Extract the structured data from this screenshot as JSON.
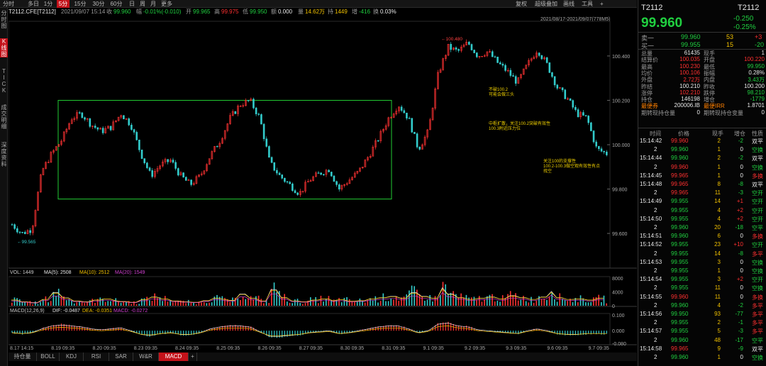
{
  "toolbar": {
    "tabs": [
      "分时",
      "多日",
      "1分",
      "5分",
      "15分",
      "30分",
      "60分",
      "日",
      "周",
      "月",
      "更多"
    ],
    "active": "5分",
    "right": [
      "复权",
      "超级叠加",
      "画线",
      "工具",
      "+"
    ]
  },
  "sidebar": {
    "items": [
      "分\n时\n图",
      "K\n线\n图",
      "T\nI\nC\nK",
      "成\n交\n明\n细",
      "深\n度\n资\n料"
    ],
    "active": 1
  },
  "info": {
    "symbol": "T2112.CFE[T2112]",
    "datetime": "2021/09/07 15:14",
    "close_label": "收",
    "close": "99.960",
    "change_label": "幅",
    "change": "-0.01%(-0.010)",
    "open_label": "开",
    "open": "99.965",
    "high_label": "高",
    "high": "99.975",
    "low_label": "低",
    "low": "99.950",
    "amount_label": "额",
    "amount": "0.000",
    "vol_label": "量",
    "vol": "14.62万",
    "oi_label": "持",
    "oi": "1449",
    "oi_chg_label": "增",
    "oi_chg": "-416",
    "turnover_label": "换",
    "turnover": "0.03%"
  },
  "range": "2021/08/17-2021/09/07(778M5)",
  "chart_data": [
    {
      "type": "candlestick",
      "ylim": [
        99.45,
        100.55
      ],
      "yticks": [
        "100.400",
        "100.200",
        "100.000",
        "99.800",
        "99.600"
      ],
      "high_label": "100.480",
      "low_label": "99.565",
      "x_labels": [
        "8.17 14:15",
        "8.19 09:35",
        "8.20 09:35",
        "8.23 09:35",
        "8.24 09:35",
        "8.25 09:35",
        "8.26 09:35",
        "8.27 09:35",
        "8.30 09:35",
        "8.31 09:35",
        "9.1 09:35",
        "9.2 09:35",
        "9.3 09:35",
        "9.6 09:35",
        "9.7 09:35"
      ],
      "close": [
        99.64,
        99.6,
        99.62,
        99.88,
        99.96,
        100.02,
        100.12,
        100.14,
        100.09,
        100.06,
        100.08,
        100.14,
        100.09,
        99.96,
        99.86,
        99.91,
        99.93,
        99.86,
        99.82,
        99.86,
        99.95,
        100.02,
        100.12,
        100.18,
        100.2,
        100.12,
        99.92,
        99.86,
        99.82,
        99.78,
        99.84,
        99.87,
        99.89,
        99.8,
        99.84,
        99.88,
        99.95,
        100.03,
        100.12,
        100.18,
        100.12,
        99.98,
        100.06,
        100.32,
        100.44,
        100.42,
        100.46,
        100.4,
        100.42,
        100.37,
        100.33,
        100.28,
        100.36,
        100.43,
        100.36,
        100.26,
        100.21,
        100.14,
        100.12,
        99.98,
        99.96
      ],
      "annotations": [
        "不破100.2\n可能会做三头",
        "中枢扩散，关注100.2突破有效性\n100.3附近压力位",
        "关注100的支撑性\n100.2-100.3做空观有效性有点\n找空"
      ]
    },
    {
      "type": "bar",
      "title": "VOL: 1449",
      "ma5": "MA(5): 2508",
      "ma10": "MA(10): 2512",
      "ma20": "MA(20): 1549",
      "ylim": [
        0,
        8000
      ],
      "yticks": [
        "8000",
        "4000",
        "0"
      ],
      "values": [
        1800,
        1200,
        900,
        2000,
        4200,
        2500,
        1500,
        1200,
        1800,
        2200,
        1600,
        1300,
        1000,
        1900,
        2800,
        2200,
        1500,
        1200,
        1000,
        1600,
        2400,
        2000,
        1700,
        3800,
        2400,
        1500,
        5200,
        2600,
        1500,
        1200,
        1800,
        2200,
        1500,
        1900,
        1400,
        1600,
        2200,
        2600,
        3000,
        2400,
        4200,
        3000,
        2400,
        5800,
        3800,
        2600,
        2000,
        2400,
        2800,
        2200,
        3200,
        2600,
        2000,
        2800,
        4600,
        2600,
        2000,
        2200,
        1800,
        2400,
        1449
      ]
    },
    {
      "type": "bar",
      "title": "MACD(12,26,9)",
      "dif": "DIF: -0.0487",
      "dea": "DEA: -0.0351",
      "macd": "MACD: -0.0272",
      "ylim": [
        -0.08,
        0.1
      ],
      "yticks": [
        "0.100",
        "0.000",
        "-0.080"
      ],
      "macd_values": [
        -0.02,
        -0.03,
        -0.02,
        0.02,
        0.05,
        0.06,
        0.05,
        0.04,
        0.02,
        0.01,
        0.02,
        0.03,
        0.0,
        -0.04,
        -0.05,
        -0.03,
        -0.02,
        -0.04,
        -0.04,
        -0.02,
        0.02,
        0.04,
        0.05,
        0.05,
        0.04,
        -0.01,
        -0.06,
        -0.06,
        -0.05,
        -0.04,
        -0.02,
        -0.01,
        0.0,
        -0.03,
        -0.02,
        0.0,
        0.02,
        0.04,
        0.05,
        0.05,
        0.02,
        -0.02,
        0.0,
        0.07,
        0.08,
        0.05,
        0.04,
        0.01,
        0.0,
        -0.01,
        -0.02,
        -0.03,
        0.0,
        0.02,
        0.0,
        -0.03,
        -0.04,
        -0.04,
        -0.03,
        -0.03,
        -0.03
      ]
    }
  ],
  "bottom_tabs": [
    "持仓量",
    "BOLL",
    "KDJ",
    "RSI",
    "SAR",
    "W&R",
    "MACD",
    "+"
  ],
  "bottom_active": "MACD",
  "quote": {
    "code": "T2112",
    "code2": "T2112",
    "change": "-0.250",
    "pct": "-0.25%",
    "price": "99.960",
    "orders": [
      [
        "卖一",
        "99.960",
        "53",
        "+3"
      ],
      [
        "买一",
        "99.955",
        "15",
        "-20"
      ]
    ],
    "stats": [
      [
        "总量",
        "61435",
        "现手",
        "1"
      ],
      [
        "结算价",
        "100.035",
        "开盘",
        "100.220"
      ],
      [
        "最高",
        "100.230",
        "最低",
        "99.950"
      ],
      [
        "均价",
        "100.106",
        "振幅",
        "0.28%"
      ],
      [
        "外盘",
        "2.72万",
        "内盘",
        "3.43万"
      ],
      [
        "昨结",
        "100.210",
        "昨收",
        "100.200"
      ],
      [
        "涨停",
        "102.210",
        "跌停",
        "98.210"
      ],
      [
        "持仓",
        "146198",
        "增仓",
        "-1779"
      ],
      [
        "最便券",
        "200006.IB",
        "最便IRR",
        "1.8701"
      ],
      [
        "期转现持仓量",
        "0",
        "期转现持仓变量",
        "0"
      ]
    ],
    "tick_header": [
      "时间",
      "价格",
      "现手",
      "增仓",
      "性质"
    ],
    "ticks": [
      [
        "15:14:42",
        "99.960",
        "2",
        "-2",
        "双平"
      ],
      [
        "2",
        "99.960",
        "1",
        "0",
        "空换"
      ],
      [
        "15:14:44",
        "99.960",
        "2",
        "-2",
        "双平"
      ],
      [
        "2",
        "99.960",
        "1",
        "0",
        "空换"
      ],
      [
        "15:14:45",
        "99.965",
        "1",
        "0",
        "多换"
      ],
      [
        "15:14:48",
        "99.965",
        "8",
        "-8",
        "双平"
      ],
      [
        "2",
        "99.965",
        "11",
        "-3",
        "空开"
      ],
      [
        "15:14:49",
        "99.955",
        "14",
        "+1",
        "空开"
      ],
      [
        "2",
        "99.955",
        "4",
        "+2",
        "空开"
      ],
      [
        "15:14:50",
        "99.955",
        "4",
        "+2",
        "空开"
      ],
      [
        "2",
        "99.960",
        "20",
        "-18",
        "空平"
      ],
      [
        "15:14:51",
        "99.960",
        "6",
        "0",
        "多换"
      ],
      [
        "15:14:52",
        "99.955",
        "23",
        "+10",
        "空开"
      ],
      [
        "2",
        "99.955",
        "14",
        "-8",
        "多平"
      ],
      [
        "15:14:53",
        "99.955",
        "3",
        "0",
        "空换"
      ],
      [
        "2",
        "99.955",
        "1",
        "0",
        "空换"
      ],
      [
        "15:14:54",
        "99.955",
        "3",
        "+2",
        "空开"
      ],
      [
        "2",
        "99.955",
        "11",
        "0",
        "空换"
      ],
      [
        "15:14:55",
        "99.960",
        "11",
        "0",
        "多换"
      ],
      [
        "2",
        "99.960",
        "4",
        "-2",
        "多平"
      ],
      [
        "15:14:56",
        "99.950",
        "93",
        "-77",
        "多平"
      ],
      [
        "2",
        "99.955",
        "2",
        "-1",
        "多平"
      ],
      [
        "15:14:57",
        "99.955",
        "5",
        "-3",
        "多平"
      ],
      [
        "2",
        "99.960",
        "48",
        "-17",
        "空平"
      ],
      [
        "15:14:58",
        "99.965",
        "9",
        "-9",
        "双平"
      ],
      [
        "2",
        "99.960",
        "1",
        "0",
        "空换"
      ]
    ]
  }
}
